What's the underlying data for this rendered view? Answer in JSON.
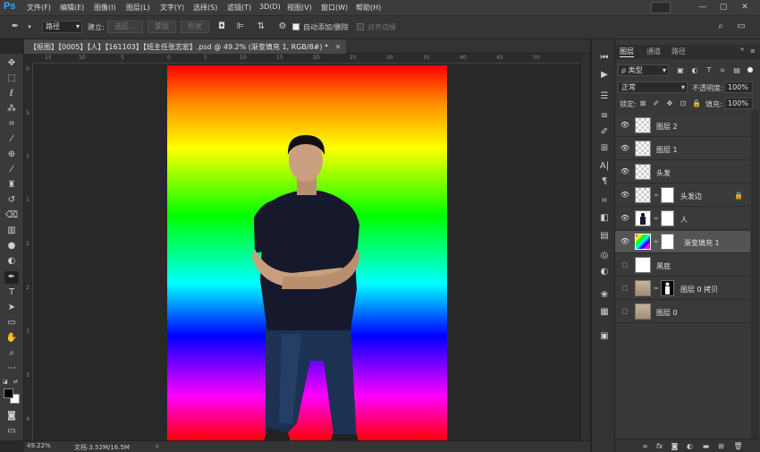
{
  "app": {
    "logo": "Ps",
    "menu": [
      "文件(F)",
      "编辑(E)",
      "图像(I)",
      "图层(L)",
      "文字(Y)",
      "选择(S)",
      "滤镜(T)",
      "3D(D)",
      "视图(V)",
      "窗口(W)",
      "帮助(H)"
    ],
    "window_buttons": [
      "—",
      "▢",
      "✕"
    ]
  },
  "options": {
    "tool_icon": "pen-icon",
    "mode_select": "路径",
    "make_label": "建立:",
    "selection_btn": "选区...",
    "mask_btn": "蒙版",
    "shape_btn": "形状",
    "auto_add_label": "自动添加/删除",
    "align_edges_label": "对齐边缘"
  },
  "document": {
    "tab_title": "【抠图】【0005】【人】【161103】【班主任张志宏】.psd @ 49.2% (渐变填充 1, RGB/8#) *",
    "tab_close": "✕"
  },
  "rulers": {
    "top": [
      "0",
      "15",
      "10",
      "5",
      "0",
      "5",
      "10",
      "15",
      "20",
      "25",
      "30",
      "35",
      "40",
      "45",
      "50"
    ],
    "left": [
      "0",
      "5",
      "1",
      "1",
      "2",
      "2",
      "3",
      "3",
      "4"
    ]
  },
  "status": {
    "zoom": "49.22%",
    "doc": "文档:3.52M/16.5M",
    "arrow": "›"
  },
  "panel": {
    "tabs": [
      "图层",
      "通道",
      "路径"
    ],
    "filter_select": "ρ 类型",
    "blend_mode": "正常",
    "opacity_label": "不透明度:",
    "opacity_value": "100%",
    "lock_label": "锁定:",
    "fill_label": "填充:",
    "fill_value": "100%"
  },
  "layers": [
    {
      "name": "图层 2",
      "visible": true
    },
    {
      "name": "图层 1",
      "visible": true
    },
    {
      "name": "头发",
      "visible": true
    },
    {
      "name": "头发边",
      "visible": true
    },
    {
      "name": "人",
      "visible": true
    },
    {
      "name": "渐变填充 1",
      "visible": true
    },
    {
      "name": "黑底",
      "visible": false
    },
    {
      "name": "图层 0 拷贝",
      "visible": false
    },
    {
      "name": "图层 0",
      "visible": false
    }
  ],
  "colors": {
    "ps_blue": "#31a8ff",
    "selected_layer": "#545454"
  }
}
